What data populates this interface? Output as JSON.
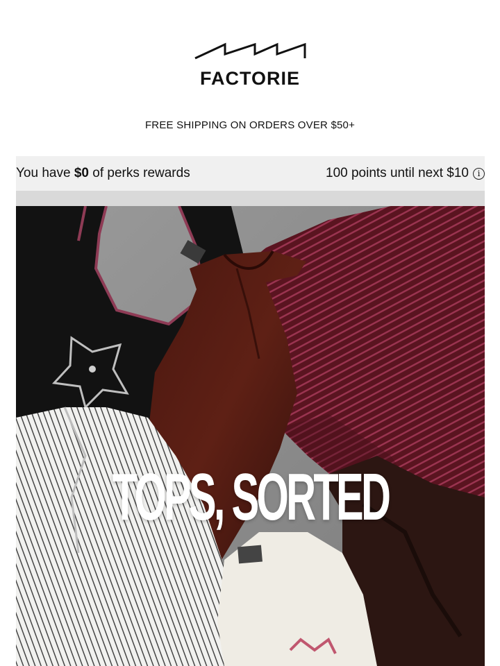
{
  "brand": {
    "name": "FACTORIE",
    "logo_icon": "factorie-sawtooth-logo-icon"
  },
  "shipping_banner": "FREE SHIPPING ON ORDERS OVER $50+",
  "perks": {
    "prefix": "You have ",
    "amount": "$0",
    "suffix": " of perks rewards",
    "points_text": "100 points until next $10",
    "info_icon": "info-icon"
  },
  "hero": {
    "headline": "TOPS, SORTED",
    "image_description_icon": "clothing-flatlay-image"
  },
  "colors": {
    "text": "#111111",
    "perks_bg": "#f0f0f0",
    "strip_bg": "#d9d9d9",
    "headline": "#ffffff"
  }
}
